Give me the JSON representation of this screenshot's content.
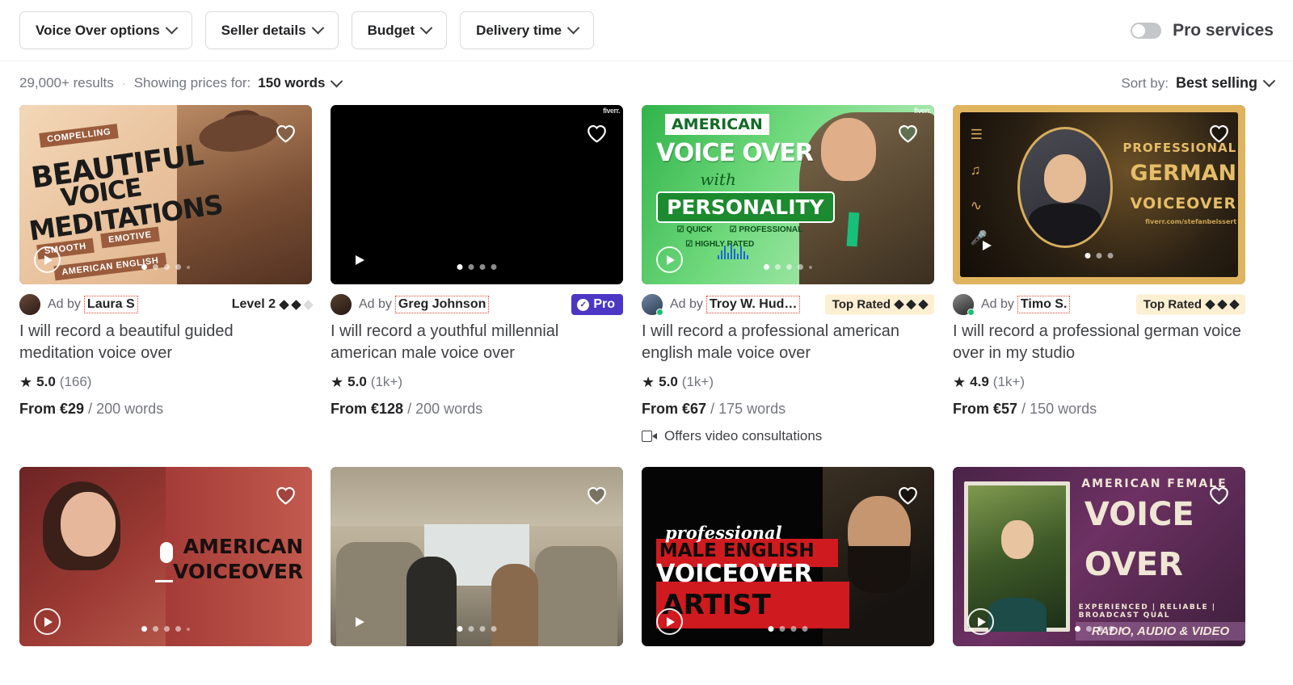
{
  "filter_bar": {
    "chips": [
      {
        "label": "Voice Over options",
        "icon": "chevron-down-icon"
      },
      {
        "label": "Seller details",
        "icon": "chevron-down-icon"
      },
      {
        "label": "Budget",
        "icon": "chevron-down-icon"
      },
      {
        "label": "Delivery time",
        "icon": "chevron-down-icon"
      }
    ],
    "pro_toggle": {
      "label": "Pro services",
      "state": "off"
    }
  },
  "results_bar": {
    "results_count": "29,000+ results",
    "separator": "·",
    "showing_prices_for_label": "Showing prices for:",
    "words_value": "150 words",
    "sort_label": "Sort by:",
    "sort_value": "Best selling"
  },
  "colors": {
    "pro_badge_bg": "#4c36c4",
    "top_rated_bg": "#fdefd2",
    "online_dot": "#1dbf73",
    "highlight_outline": "#e8402a",
    "text_primary": "#222325",
    "text_muted": "#74767e"
  },
  "cards": [
    {
      "seller": "Laura S",
      "ad_by": "Ad by",
      "badge_type": "level",
      "badge_label": "Level 2",
      "badge_diamonds_filled": 2,
      "badge_diamonds_total": 3,
      "title": "I will record a beautiful guided meditation voice over",
      "rating": "5.0",
      "reviews": "(166)",
      "price": "From €29",
      "price_unit": "/ 200 words",
      "consultations": null,
      "thumb_dots": 5,
      "thumb_active_dot": 0,
      "watermark": null,
      "thumb_text": {
        "ribbon1": "COMPELLING",
        "line1": "BEAUTIFUL",
        "line2": "VOICE",
        "line3": "MEDITATIONS",
        "ribbon2": "SMOOTH",
        "ribbon3": "EMOTIVE",
        "ribbon4": "AMERICAN ENGLISH"
      }
    },
    {
      "seller": "Greg Johnson",
      "ad_by": "Ad by",
      "badge_type": "pro",
      "badge_label": "Pro",
      "title": "I will record a youthful millennial american male voice over",
      "rating": "5.0",
      "reviews": "(1k+)",
      "price": "From €128",
      "price_unit": "/ 200 words",
      "consultations": null,
      "thumb_dots": 4,
      "thumb_active_dot": 0,
      "watermark": "fiverr.",
      "thumb_text": {}
    },
    {
      "seller": "Troy W. Hud…",
      "ad_by": "Ad by",
      "badge_type": "toprated",
      "badge_label": "Top Rated",
      "badge_diamonds_filled": 3,
      "badge_diamonds_total": 3,
      "title": "I will record a professional american english male voice over",
      "rating": "5.0",
      "reviews": "(1k+)",
      "price": "From €67",
      "price_unit": "/ 175 words",
      "consultations": "Offers video consultations",
      "thumb_dots": 5,
      "thumb_active_dot": 0,
      "watermark": "fiverr.",
      "thumb_text": {
        "line1": "AMERICAN",
        "line2": "VOICE OVER",
        "line3": "with",
        "line4": "PERSONALITY",
        "check1": "QUICK",
        "check2": "PROFESSIONAL",
        "check3": "HIGHLY RATED"
      }
    },
    {
      "seller": "Timo S.",
      "ad_by": "Ad by",
      "badge_type": "toprated",
      "badge_label": "Top Rated",
      "badge_diamonds_filled": 3,
      "badge_diamonds_total": 3,
      "title": "I will record a professional german voice over in my studio",
      "rating": "4.9",
      "reviews": "(1k+)",
      "price": "From €57",
      "price_unit": "/ 150 words",
      "consultations": null,
      "thumb_dots": 3,
      "thumb_active_dot": 0,
      "watermark": null,
      "thumb_text": {
        "line1": "PROFESSIONAL",
        "line2": "GERMAN",
        "line3": "VOICEOVER",
        "line4": "fiverr.com/stefanbeissert"
      }
    },
    {
      "seller": "",
      "badge_type": "none",
      "title": "",
      "thumb_dots": 5,
      "thumb_active_dot": 0,
      "thumb_text": {
        "line1": "AMERICAN",
        "line2": "VOICEOVER"
      }
    },
    {
      "seller": "",
      "badge_type": "none",
      "title": "",
      "thumb_dots": 4,
      "thumb_active_dot": 0,
      "thumb_text": {}
    },
    {
      "seller": "",
      "badge_type": "none",
      "title": "",
      "thumb_dots": 4,
      "thumb_active_dot": 0,
      "thumb_text": {
        "line1": "professional",
        "line2": "MALE ENGLISH",
        "line3": "VOICEOVER",
        "line4": "ARTIST"
      }
    },
    {
      "seller": "",
      "badge_type": "none",
      "title": "",
      "thumb_dots": 5,
      "thumb_active_dot": 0,
      "thumb_text": {
        "line1": "AMERICAN FEMALE",
        "line2": "VOICE",
        "line3": "OVER",
        "line4": "EXPERIENCED  |  RELIABLE  |  BROADCAST QUAL",
        "line5": "RADIO, AUDIO & VIDEO"
      }
    }
  ]
}
